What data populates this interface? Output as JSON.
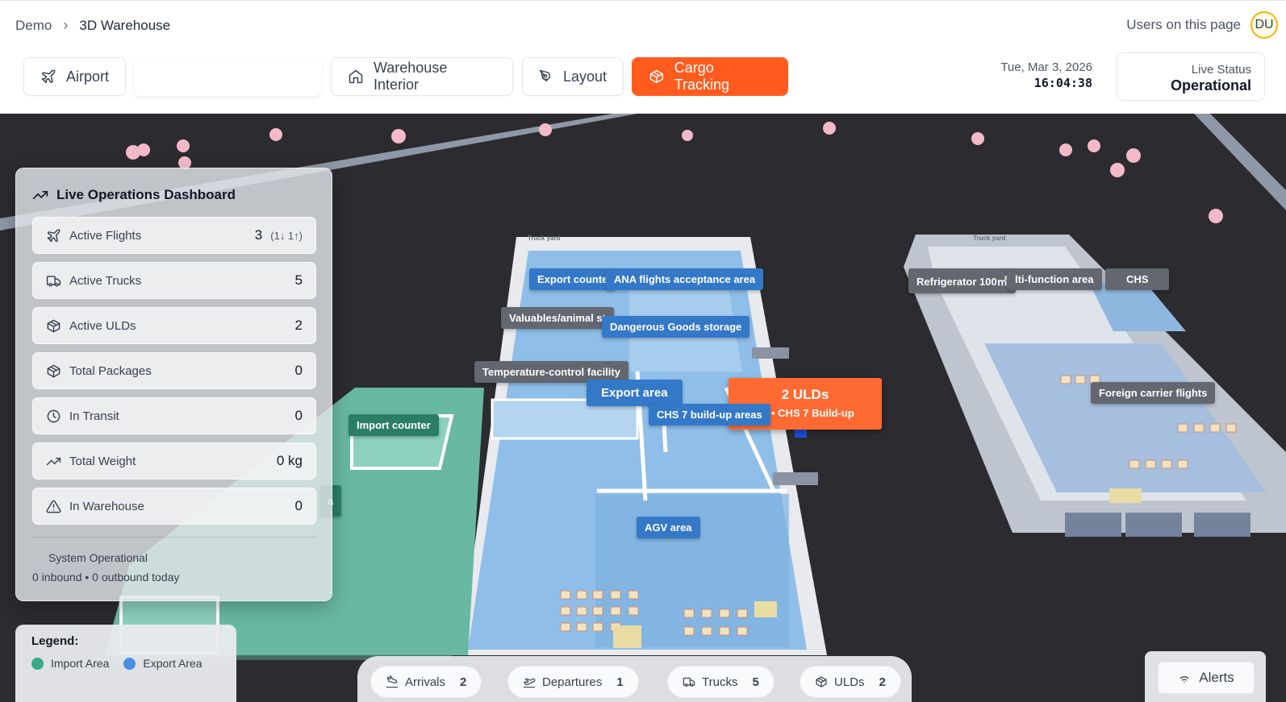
{
  "breadcrumb": {
    "root": "Demo",
    "separator": "›",
    "current": "3D Warehouse"
  },
  "users": {
    "label": "Users on this page",
    "avatar": "DU"
  },
  "tabs": [
    {
      "label": "Airport",
      "icon": "plane-icon"
    },
    {
      "label": "Warehouse Interior",
      "icon": "home-icon"
    },
    {
      "label": "Layout",
      "icon": "pen-tool-icon"
    },
    {
      "label": "Cargo Tracking",
      "icon": "package-icon",
      "active": true
    }
  ],
  "datetime": {
    "date": "Tue, Mar 3, 2026",
    "time": "16:04:38"
  },
  "live_status": {
    "label": "Live Status",
    "value": "Operational"
  },
  "dashboard": {
    "title": "Live Operations Dashboard",
    "stats": [
      {
        "label": "Active Flights",
        "value": "3",
        "sub": "(1↓ 1↑)",
        "icon": "plane-icon"
      },
      {
        "label": "Active Trucks",
        "value": "5",
        "icon": "truck-icon"
      },
      {
        "label": "Active ULDs",
        "value": "2",
        "icon": "package-icon"
      },
      {
        "label": "Total Packages",
        "value": "0",
        "icon": "package-icon"
      },
      {
        "label": "In Transit",
        "value": "0",
        "icon": "clock-icon"
      },
      {
        "label": "Total Weight",
        "value": "0 kg",
        "icon": "trending-up-icon"
      },
      {
        "label": "In Warehouse",
        "value": "0",
        "icon": "alert-triangle-icon"
      }
    ],
    "system_status": "System Operational",
    "footer": "0 inbound • 0 outbound today"
  },
  "zones": {
    "truck_yard_1": "Truck yard",
    "truck_yard_2": "Truck yard",
    "export_counter": "Export counte",
    "ana_acceptance": "ANA flights acceptance area",
    "valuables": "Valuables/animal st",
    "dangerous_goods": "Dangerous Goods storage",
    "temperature_control": "Temperature-control facility",
    "export_area": "Export area",
    "chs7_buildup": "CHS 7 build-up areas",
    "import_counter": "Import counter",
    "import_area_partial": "a",
    "agv_area": "AGV area",
    "refrigerator": "Refrigerator 100㎡",
    "multi_function": "lti-function area",
    "chs": "CHS",
    "foreign_carrier": "Foreign carrier flights"
  },
  "uld_callout": {
    "title": "2 ULDs",
    "subtitle": "dy • CHS 7 Build-up"
  },
  "legend": {
    "title": "Legend:",
    "items": [
      {
        "label": "Import Area",
        "color": "#3ba889"
      },
      {
        "label": "Export Area",
        "color": "#4a90e2"
      }
    ]
  },
  "bottom_bar": [
    {
      "label": "Arrivals",
      "count": "2",
      "icon": "plane-landing-icon"
    },
    {
      "label": "Departures",
      "count": "1",
      "icon": "plane-takeoff-icon"
    },
    {
      "label": "Trucks",
      "count": "5",
      "icon": "truck-icon"
    },
    {
      "label": "ULDs",
      "count": "2",
      "icon": "package-icon"
    }
  ],
  "alerts": {
    "label": "Alerts",
    "icon": "wifi-icon"
  },
  "colors": {
    "accent": "#ff5b1f",
    "export_zone": "#4a90e2",
    "import_zone": "#3ba889",
    "ground": "#2b2b30"
  }
}
